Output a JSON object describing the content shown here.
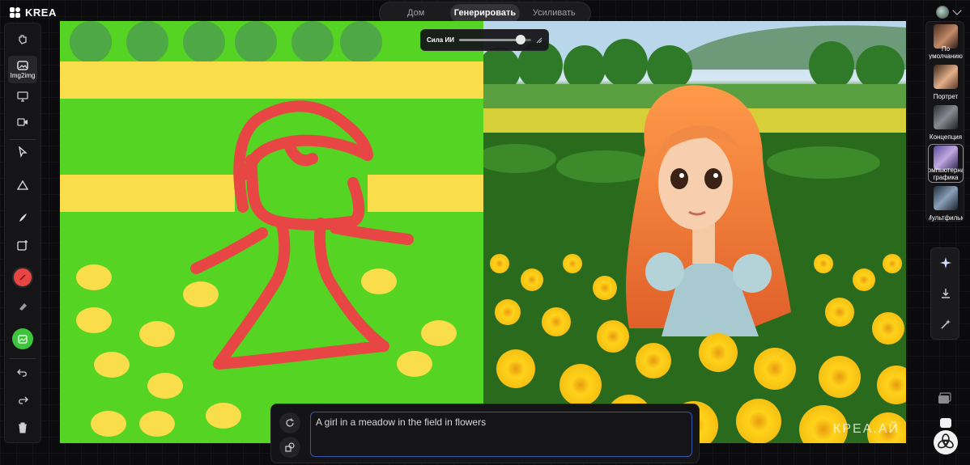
{
  "app": {
    "name": "KREA"
  },
  "nav": {
    "tabs": [
      {
        "label": "Дом"
      },
      {
        "label": "Генерировать",
        "active": true
      },
      {
        "label": "Усиливать"
      }
    ]
  },
  "toolbar": {
    "img2img_label": "Img2img",
    "tools": [
      "pan-hand-icon",
      "image-icon",
      "monitor-icon",
      "video-icon",
      "cursor-icon",
      "triangle-icon",
      "brush-icon",
      "add-image-icon",
      "color-picker-icon",
      "eraser-icon",
      "image-fill-icon",
      "undo-icon",
      "redo-icon",
      "trash-icon"
    ],
    "active_color": "#e84545",
    "fill_button_color": "#3cc43a"
  },
  "ai_strength": {
    "label": "Сила ИИ",
    "value": 0.85
  },
  "prompt": {
    "text": "A girl in a meadow in the field in flowers"
  },
  "styles": [
    {
      "label": "По\nумолчанию"
    },
    {
      "label": "Портрет"
    },
    {
      "label": "Концепция"
    },
    {
      "label": "Компьютерная\nграфика",
      "selected": true
    },
    {
      "label": "Мультфильм"
    }
  ],
  "result": {
    "watermark": "КРЕА.АЙ"
  },
  "colors": {
    "canvas_green": "#55d423",
    "stroke_red": "#e84545",
    "yellow": "#ffde4a",
    "accent_blue": "#3356ae"
  }
}
